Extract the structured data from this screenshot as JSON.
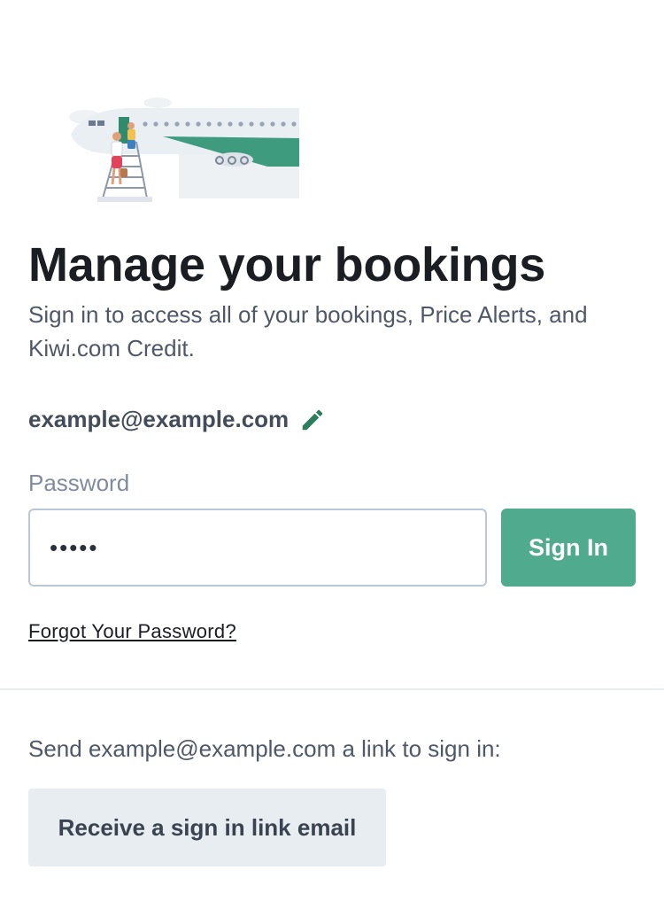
{
  "header": {
    "illustration_icon": "airplane-boarding-illustration",
    "title": "Manage your bookings",
    "subtitle": "Sign in to access all of your bookings, Price Alerts, and Kiwi.com Credit."
  },
  "account": {
    "email": "example@example.com",
    "edit_icon": "pencil-icon"
  },
  "password": {
    "label": "Password",
    "value": "•••••"
  },
  "actions": {
    "sign_in_label": "Sign In",
    "forgot_label": "Forgot Your Password?"
  },
  "magic_link": {
    "text": "Send example@example.com a link to sign in:",
    "button_label": "Receive a sign in link email"
  },
  "colors": {
    "primary": "#4faa8e",
    "edit_icon": "#2e7d5f",
    "secondary_button_bg": "#e8edf1"
  }
}
